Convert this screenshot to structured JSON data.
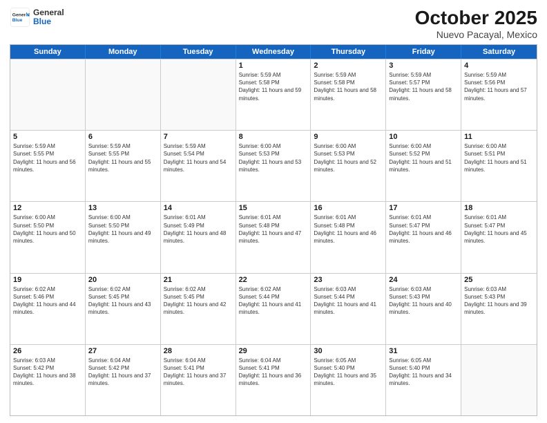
{
  "header": {
    "logo_general": "General",
    "logo_blue": "Blue",
    "month": "October 2025",
    "location": "Nuevo Pacayal, Mexico"
  },
  "days_of_week": [
    "Sunday",
    "Monday",
    "Tuesday",
    "Wednesday",
    "Thursday",
    "Friday",
    "Saturday"
  ],
  "weeks": [
    [
      {
        "day": "",
        "empty": true
      },
      {
        "day": "",
        "empty": true
      },
      {
        "day": "",
        "empty": true
      },
      {
        "day": "1",
        "sunrise": "5:59 AM",
        "sunset": "5:58 PM",
        "daylight": "11 hours and 59 minutes."
      },
      {
        "day": "2",
        "sunrise": "5:59 AM",
        "sunset": "5:58 PM",
        "daylight": "11 hours and 58 minutes."
      },
      {
        "day": "3",
        "sunrise": "5:59 AM",
        "sunset": "5:57 PM",
        "daylight": "11 hours and 58 minutes."
      },
      {
        "day": "4",
        "sunrise": "5:59 AM",
        "sunset": "5:56 PM",
        "daylight": "11 hours and 57 minutes."
      }
    ],
    [
      {
        "day": "5",
        "sunrise": "5:59 AM",
        "sunset": "5:55 PM",
        "daylight": "11 hours and 56 minutes."
      },
      {
        "day": "6",
        "sunrise": "5:59 AM",
        "sunset": "5:55 PM",
        "daylight": "11 hours and 55 minutes."
      },
      {
        "day": "7",
        "sunrise": "5:59 AM",
        "sunset": "5:54 PM",
        "daylight": "11 hours and 54 minutes."
      },
      {
        "day": "8",
        "sunrise": "6:00 AM",
        "sunset": "5:53 PM",
        "daylight": "11 hours and 53 minutes."
      },
      {
        "day": "9",
        "sunrise": "6:00 AM",
        "sunset": "5:53 PM",
        "daylight": "11 hours and 52 minutes."
      },
      {
        "day": "10",
        "sunrise": "6:00 AM",
        "sunset": "5:52 PM",
        "daylight": "11 hours and 51 minutes."
      },
      {
        "day": "11",
        "sunrise": "6:00 AM",
        "sunset": "5:51 PM",
        "daylight": "11 hours and 51 minutes."
      }
    ],
    [
      {
        "day": "12",
        "sunrise": "6:00 AM",
        "sunset": "5:50 PM",
        "daylight": "11 hours and 50 minutes."
      },
      {
        "day": "13",
        "sunrise": "6:00 AM",
        "sunset": "5:50 PM",
        "daylight": "11 hours and 49 minutes."
      },
      {
        "day": "14",
        "sunrise": "6:01 AM",
        "sunset": "5:49 PM",
        "daylight": "11 hours and 48 minutes."
      },
      {
        "day": "15",
        "sunrise": "6:01 AM",
        "sunset": "5:48 PM",
        "daylight": "11 hours and 47 minutes."
      },
      {
        "day": "16",
        "sunrise": "6:01 AM",
        "sunset": "5:48 PM",
        "daylight": "11 hours and 46 minutes."
      },
      {
        "day": "17",
        "sunrise": "6:01 AM",
        "sunset": "5:47 PM",
        "daylight": "11 hours and 46 minutes."
      },
      {
        "day": "18",
        "sunrise": "6:01 AM",
        "sunset": "5:47 PM",
        "daylight": "11 hours and 45 minutes."
      }
    ],
    [
      {
        "day": "19",
        "sunrise": "6:02 AM",
        "sunset": "5:46 PM",
        "daylight": "11 hours and 44 minutes."
      },
      {
        "day": "20",
        "sunrise": "6:02 AM",
        "sunset": "5:45 PM",
        "daylight": "11 hours and 43 minutes."
      },
      {
        "day": "21",
        "sunrise": "6:02 AM",
        "sunset": "5:45 PM",
        "daylight": "11 hours and 42 minutes."
      },
      {
        "day": "22",
        "sunrise": "6:02 AM",
        "sunset": "5:44 PM",
        "daylight": "11 hours and 41 minutes."
      },
      {
        "day": "23",
        "sunrise": "6:03 AM",
        "sunset": "5:44 PM",
        "daylight": "11 hours and 41 minutes."
      },
      {
        "day": "24",
        "sunrise": "6:03 AM",
        "sunset": "5:43 PM",
        "daylight": "11 hours and 40 minutes."
      },
      {
        "day": "25",
        "sunrise": "6:03 AM",
        "sunset": "5:43 PM",
        "daylight": "11 hours and 39 minutes."
      }
    ],
    [
      {
        "day": "26",
        "sunrise": "6:03 AM",
        "sunset": "5:42 PM",
        "daylight": "11 hours and 38 minutes."
      },
      {
        "day": "27",
        "sunrise": "6:04 AM",
        "sunset": "5:42 PM",
        "daylight": "11 hours and 37 minutes."
      },
      {
        "day": "28",
        "sunrise": "6:04 AM",
        "sunset": "5:41 PM",
        "daylight": "11 hours and 37 minutes."
      },
      {
        "day": "29",
        "sunrise": "6:04 AM",
        "sunset": "5:41 PM",
        "daylight": "11 hours and 36 minutes."
      },
      {
        "day": "30",
        "sunrise": "6:05 AM",
        "sunset": "5:40 PM",
        "daylight": "11 hours and 35 minutes."
      },
      {
        "day": "31",
        "sunrise": "6:05 AM",
        "sunset": "5:40 PM",
        "daylight": "11 hours and 34 minutes."
      },
      {
        "day": "",
        "empty": true
      }
    ]
  ]
}
